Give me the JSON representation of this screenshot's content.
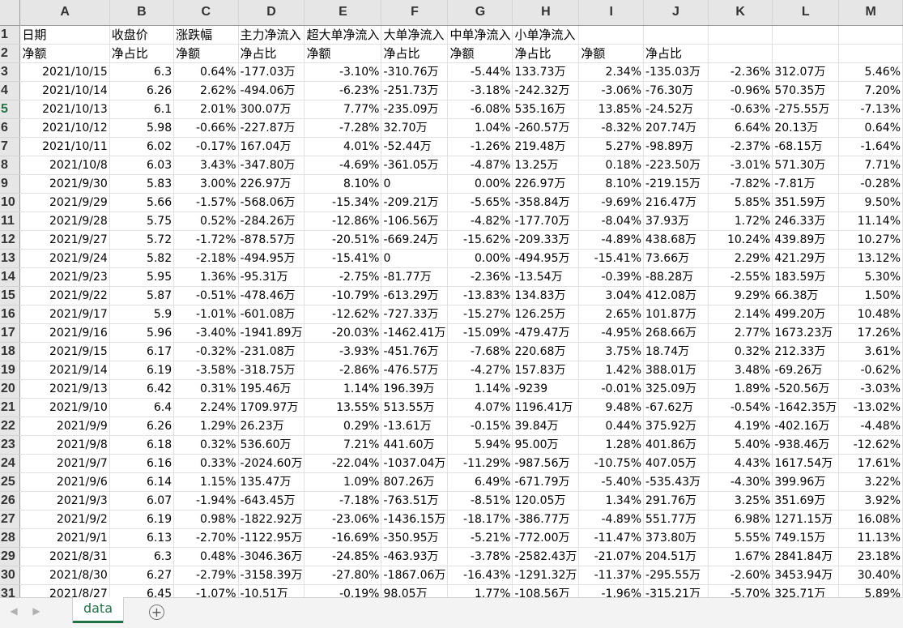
{
  "columns": [
    "A",
    "B",
    "C",
    "D",
    "E",
    "F",
    "G",
    "H",
    "I",
    "J",
    "K",
    "L",
    "M"
  ],
  "header_row1": [
    "日期",
    "收盘价",
    "涨跌幅",
    "主力净流入",
    "超大单净流入",
    "大单净流入",
    "中单净流入",
    "小单净流入",
    "",
    "",
    "",
    "",
    ""
  ],
  "header_row2": [
    "净额",
    "净占比",
    "净额",
    "净占比",
    "净额",
    "净占比",
    "净额",
    "净占比",
    "净额",
    "净占比",
    "",
    "",
    ""
  ],
  "rows": [
    [
      "2021/10/15",
      "6.3",
      "0.64%",
      "-177.03万",
      "-3.10%",
      "-310.76万",
      "-5.44%",
      "133.73万",
      "2.34%",
      "-135.03万",
      "-2.36%",
      "312.07万",
      "5.46%"
    ],
    [
      "2021/10/14",
      "6.26",
      "2.62%",
      "-494.06万",
      "-6.23%",
      "-251.73万",
      "-3.18%",
      "-242.32万",
      "-3.06%",
      "-76.30万",
      "-0.96%",
      "570.35万",
      "7.20%"
    ],
    [
      "2021/10/13",
      "6.1",
      "2.01%",
      "300.07万",
      "7.77%",
      "-235.09万",
      "-6.08%",
      "535.16万",
      "13.85%",
      "-24.52万",
      "-0.63%",
      "-275.55万",
      "-7.13%"
    ],
    [
      "2021/10/12",
      "5.98",
      "-0.66%",
      "-227.87万",
      "-7.28%",
      "32.70万",
      "1.04%",
      "-260.57万",
      "-8.32%",
      "207.74万",
      "6.64%",
      "20.13万",
      "0.64%"
    ],
    [
      "2021/10/11",
      "6.02",
      "-0.17%",
      "167.04万",
      "4.01%",
      "-52.44万",
      "-1.26%",
      "219.48万",
      "5.27%",
      "-98.89万",
      "-2.37%",
      "-68.15万",
      "-1.64%"
    ],
    [
      "2021/10/8",
      "6.03",
      "3.43%",
      "-347.80万",
      "-4.69%",
      "-361.05万",
      "-4.87%",
      "13.25万",
      "0.18%",
      "-223.50万",
      "-3.01%",
      "571.30万",
      "7.71%"
    ],
    [
      "2021/9/30",
      "5.83",
      "3.00%",
      "226.97万",
      "8.10%",
      "0",
      "0.00%",
      "226.97万",
      "8.10%",
      "-219.15万",
      "-7.82%",
      "-7.81万",
      "-0.28%"
    ],
    [
      "2021/9/29",
      "5.66",
      "-1.57%",
      "-568.06万",
      "-15.34%",
      "-209.21万",
      "-5.65%",
      "-358.84万",
      "-9.69%",
      "216.47万",
      "5.85%",
      "351.59万",
      "9.50%"
    ],
    [
      "2021/9/28",
      "5.75",
      "0.52%",
      "-284.26万",
      "-12.86%",
      "-106.56万",
      "-4.82%",
      "-177.70万",
      "-8.04%",
      "37.93万",
      "1.72%",
      "246.33万",
      "11.14%"
    ],
    [
      "2021/9/27",
      "5.72",
      "-1.72%",
      "-878.57万",
      "-20.51%",
      "-669.24万",
      "-15.62%",
      "-209.33万",
      "-4.89%",
      "438.68万",
      "10.24%",
      "439.89万",
      "10.27%"
    ],
    [
      "2021/9/24",
      "5.82",
      "-2.18%",
      "-494.95万",
      "-15.41%",
      "0",
      "0.00%",
      "-494.95万",
      "-15.41%",
      "73.66万",
      "2.29%",
      "421.29万",
      "13.12%"
    ],
    [
      "2021/9/23",
      "5.95",
      "1.36%",
      "-95.31万",
      "-2.75%",
      "-81.77万",
      "-2.36%",
      "-13.54万",
      "-0.39%",
      "-88.28万",
      "-2.55%",
      "183.59万",
      "5.30%"
    ],
    [
      "2021/9/22",
      "5.87",
      "-0.51%",
      "-478.46万",
      "-10.79%",
      "-613.29万",
      "-13.83%",
      "134.83万",
      "3.04%",
      "412.08万",
      "9.29%",
      "66.38万",
      "1.50%"
    ],
    [
      "2021/9/17",
      "5.9",
      "-1.01%",
      "-601.08万",
      "-12.62%",
      "-727.33万",
      "-15.27%",
      "126.25万",
      "2.65%",
      "101.87万",
      "2.14%",
      "499.20万",
      "10.48%"
    ],
    [
      "2021/9/16",
      "5.96",
      "-3.40%",
      "-1941.89万",
      "-20.03%",
      "-1462.41万",
      "-15.09%",
      "-479.47万",
      "-4.95%",
      "268.66万",
      "2.77%",
      "1673.23万",
      "17.26%"
    ],
    [
      "2021/9/15",
      "6.17",
      "-0.32%",
      "-231.08万",
      "-3.93%",
      "-451.76万",
      "-7.68%",
      "220.68万",
      "3.75%",
      "18.74万",
      "0.32%",
      "212.33万",
      "3.61%"
    ],
    [
      "2021/9/14",
      "6.19",
      "-3.58%",
      "-318.75万",
      "-2.86%",
      "-476.57万",
      "-4.27%",
      "157.83万",
      "1.42%",
      "388.01万",
      "3.48%",
      "-69.26万",
      "-0.62%"
    ],
    [
      "2021/9/13",
      "6.42",
      "0.31%",
      "195.46万",
      "1.14%",
      "196.39万",
      "1.14%",
      "-9239",
      "-0.01%",
      "325.09万",
      "1.89%",
      "-520.56万",
      "-3.03%"
    ],
    [
      "2021/9/10",
      "6.4",
      "2.24%",
      "1709.97万",
      "13.55%",
      "513.55万",
      "4.07%",
      "1196.41万",
      "9.48%",
      "-67.62万",
      "-0.54%",
      "-1642.35万",
      "-13.02%"
    ],
    [
      "2021/9/9",
      "6.26",
      "1.29%",
      "26.23万",
      "0.29%",
      "-13.61万",
      "-0.15%",
      "39.84万",
      "0.44%",
      "375.92万",
      "4.19%",
      "-402.16万",
      "-4.48%"
    ],
    [
      "2021/9/8",
      "6.18",
      "0.32%",
      "536.60万",
      "7.21%",
      "441.60万",
      "5.94%",
      "95.00万",
      "1.28%",
      "401.86万",
      "5.40%",
      "-938.46万",
      "-12.62%"
    ],
    [
      "2021/9/7",
      "6.16",
      "0.33%",
      "-2024.60万",
      "-22.04%",
      "-1037.04万",
      "-11.29%",
      "-987.56万",
      "-10.75%",
      "407.05万",
      "4.43%",
      "1617.54万",
      "17.61%"
    ],
    [
      "2021/9/6",
      "6.14",
      "1.15%",
      "135.47万",
      "1.09%",
      "807.26万",
      "6.49%",
      "-671.79万",
      "-5.40%",
      "-535.43万",
      "-4.30%",
      "399.96万",
      "3.22%"
    ],
    [
      "2021/9/3",
      "6.07",
      "-1.94%",
      "-643.45万",
      "-7.18%",
      "-763.51万",
      "-8.51%",
      "120.05万",
      "1.34%",
      "291.76万",
      "3.25%",
      "351.69万",
      "3.92%"
    ],
    [
      "2021/9/2",
      "6.19",
      "0.98%",
      "-1822.92万",
      "-23.06%",
      "-1436.15万",
      "-18.17%",
      "-386.77万",
      "-4.89%",
      "551.77万",
      "6.98%",
      "1271.15万",
      "16.08%"
    ],
    [
      "2021/9/1",
      "6.13",
      "-2.70%",
      "-1122.95万",
      "-16.69%",
      "-350.95万",
      "-5.21%",
      "-772.00万",
      "-11.47%",
      "373.80万",
      "5.55%",
      "749.15万",
      "11.13%"
    ],
    [
      "2021/8/31",
      "6.3",
      "0.48%",
      "-3046.36万",
      "-24.85%",
      "-463.93万",
      "-3.78%",
      "-2582.43万",
      "-21.07%",
      "204.51万",
      "1.67%",
      "2841.84万",
      "23.18%"
    ],
    [
      "2021/8/30",
      "6.27",
      "-2.79%",
      "-3158.39万",
      "-27.80%",
      "-1867.06万",
      "-16.43%",
      "-1291.32万",
      "-11.37%",
      "-295.55万",
      "-2.60%",
      "3453.94万",
      "30.40%"
    ],
    [
      "2021/8/27",
      "6.45",
      "-1.07%",
      "-10.51万",
      "-0.19%",
      "98.05万",
      "1.77%",
      "-108.56万",
      "-1.96%",
      "-315.21万",
      "-5.70%",
      "325.71万",
      "5.89%"
    ]
  ],
  "right_aligned_cols": [
    0,
    1,
    2,
    4,
    6,
    8,
    10,
    12
  ],
  "selected_row": 5,
  "sheet_tab": "data",
  "add_sheet_symbol": "+",
  "nav_prev": "◀",
  "nav_next": "▶",
  "colors": {
    "accent": "#217346",
    "header_bg": "#e6e6e6",
    "gridline": "#e1e1e1"
  }
}
